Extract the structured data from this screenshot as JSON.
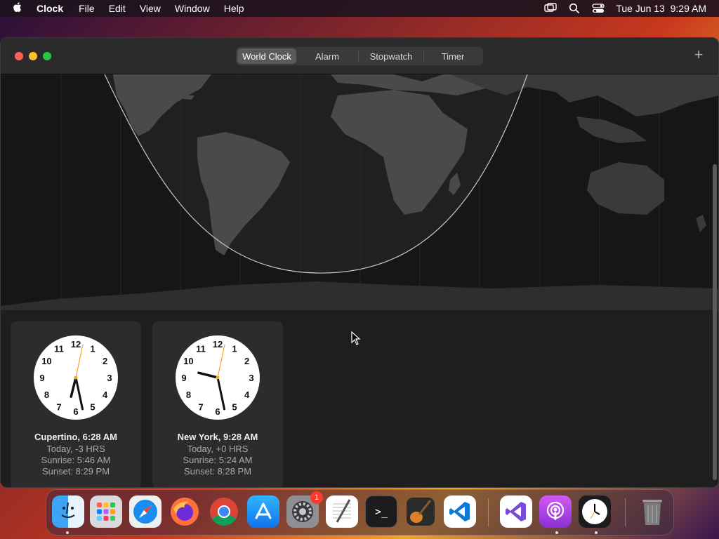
{
  "menubar": {
    "app_name": "Clock",
    "items": [
      "File",
      "Edit",
      "View",
      "Window",
      "Help"
    ],
    "datetime": "Tue Jun 13  9:29 AM"
  },
  "toolbar": {
    "tabs": [
      {
        "label": "World Clock",
        "active": true
      },
      {
        "label": "Alarm",
        "active": false
      },
      {
        "label": "Stopwatch",
        "active": false
      },
      {
        "label": "Timer",
        "active": false
      }
    ],
    "add_label": "+"
  },
  "clocks": [
    {
      "city_line": "Cupertino, 6:28 AM",
      "offset": "Today, -3 HRS",
      "sunrise": "Sunrise: 5:46 AM",
      "sunset": "Sunset: 8:29 PM",
      "hour": 6,
      "minute": 28,
      "second": 2
    },
    {
      "city_line": "New York, 9:28 AM",
      "offset": "Today, +0 HRS",
      "sunrise": "Sunrise: 5:24 AM",
      "sunset": "Sunset: 8:28 PM",
      "hour": 9,
      "minute": 28,
      "second": 2
    }
  ],
  "dock": {
    "items": [
      {
        "name": "finder",
        "icon": "finder-icon"
      },
      {
        "name": "launchpad",
        "icon": "launchpad-icon"
      },
      {
        "name": "safari",
        "icon": "safari-icon"
      },
      {
        "name": "firefox",
        "icon": "firefox-icon"
      },
      {
        "name": "chrome",
        "icon": "chrome-icon"
      },
      {
        "name": "app-store",
        "icon": "app-store-icon"
      },
      {
        "name": "system-settings",
        "icon": "gear-icon",
        "badge": "1"
      },
      {
        "name": "textedit",
        "icon": "textedit-icon"
      },
      {
        "name": "terminal",
        "icon": "terminal-icon",
        "glyph": ">_"
      },
      {
        "name": "garageband",
        "icon": "guitar-icon"
      },
      {
        "name": "vscode",
        "icon": "vscode-icon"
      },
      {
        "name": "visual-studio",
        "icon": "visual-studio-icon"
      },
      {
        "name": "podcasts",
        "icon": "podcasts-icon"
      },
      {
        "name": "clock",
        "icon": "clock-icon"
      },
      {
        "name": "trash",
        "icon": "trash-icon"
      }
    ]
  },
  "colors": {
    "window_bg": "#1e1e1e",
    "card_bg": "#2c2c2c",
    "second_hand": "#f5a623",
    "badge": "#ff3b30"
  }
}
